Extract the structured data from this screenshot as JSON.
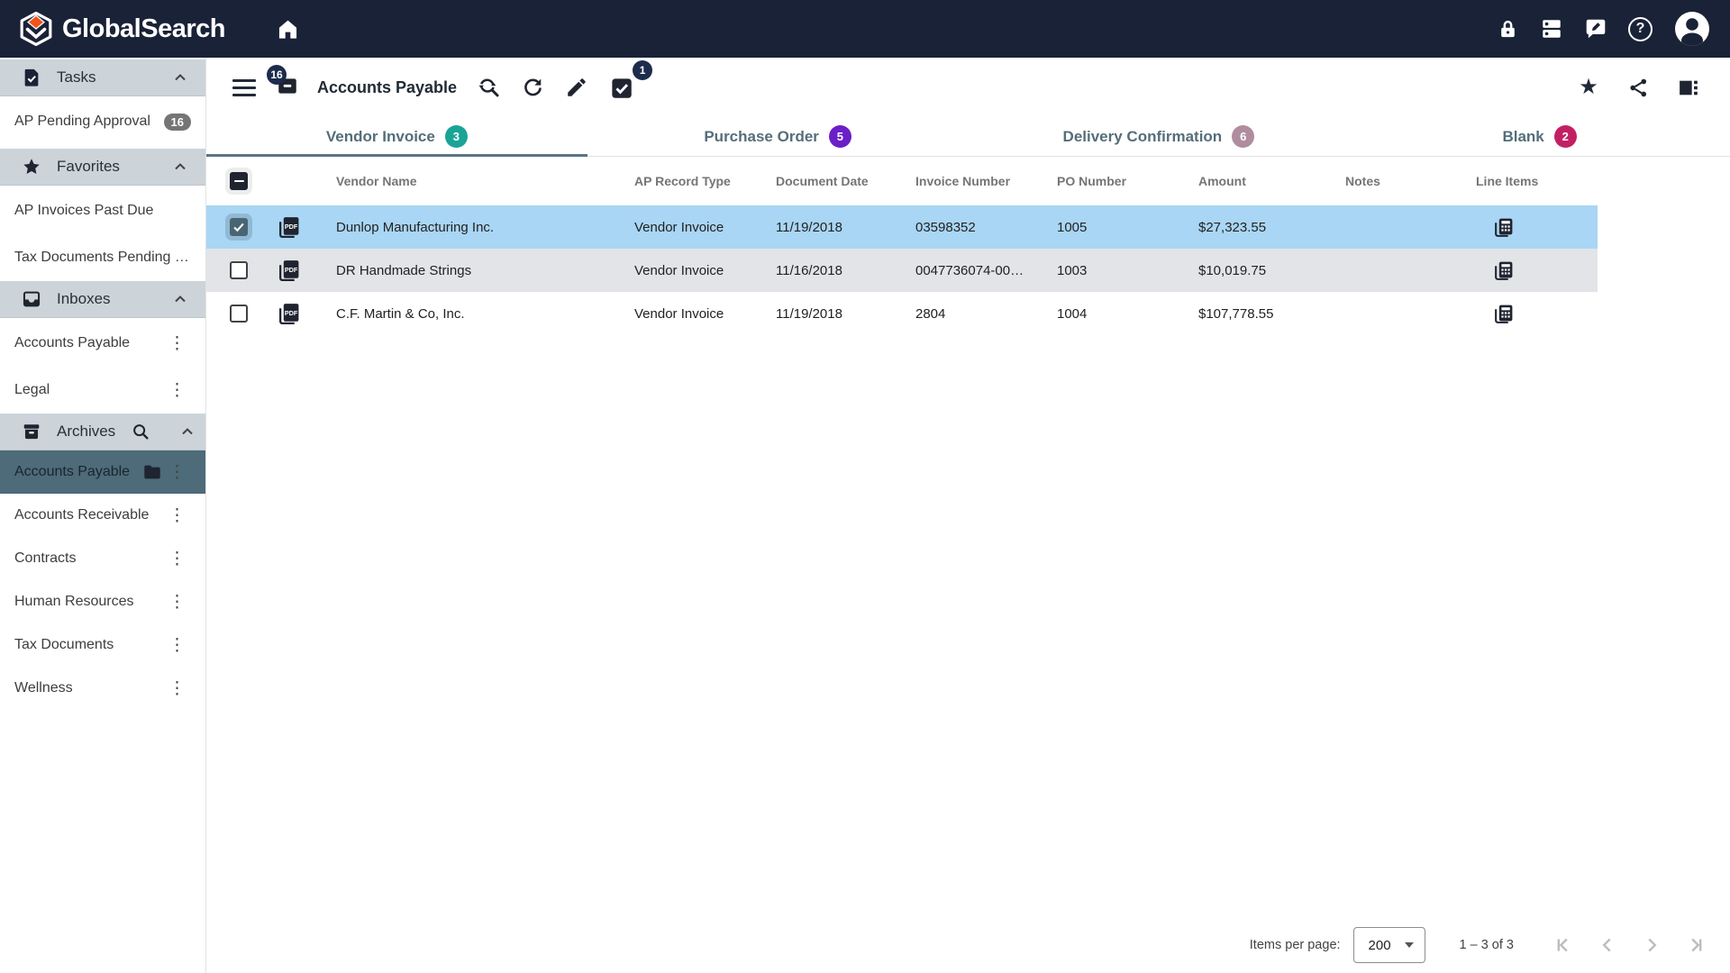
{
  "topbar": {
    "brand": "GlobalSearch",
    "icons": [
      "home-icon",
      "lock-icon",
      "dns-icon",
      "feedback-icon",
      "help-icon",
      "account-icon"
    ]
  },
  "sidebar": {
    "tasks": {
      "label": "Tasks",
      "items": [
        {
          "label": "AP Pending Approval",
          "badge": "16"
        }
      ]
    },
    "favorites": {
      "label": "Favorites",
      "items": [
        {
          "label": "AP Invoices Past Due"
        },
        {
          "label": "Tax Documents Pending Inde…"
        }
      ]
    },
    "inboxes": {
      "label": "Inboxes",
      "items": [
        {
          "label": "Accounts Payable"
        },
        {
          "label": "Legal"
        }
      ]
    },
    "archives": {
      "label": "Archives",
      "items": [
        {
          "label": "Accounts Payable",
          "selected": true
        },
        {
          "label": "Accounts Receivable"
        },
        {
          "label": "Contracts"
        },
        {
          "label": "Human Resources"
        },
        {
          "label": "Tax Documents"
        },
        {
          "label": "Wellness"
        }
      ]
    }
  },
  "toolbar": {
    "title": "Accounts Payable",
    "inbox_badge": "16",
    "multiselect_badge": "1"
  },
  "tabs": [
    {
      "label": "Vendor Invoice",
      "count": "3",
      "badge_color": "#19a496",
      "active": true
    },
    {
      "label": "Purchase Order",
      "count": "5",
      "badge_color": "#6b1fc7",
      "active": false
    },
    {
      "label": "Delivery Confirmation",
      "count": "6",
      "badge_color": "#b08c9f",
      "active": false
    },
    {
      "label": "Blank",
      "count": "2",
      "badge_color": "#c32064",
      "active": false
    }
  ],
  "table": {
    "headers": {
      "vendor": "Vendor Name",
      "type": "AP Record Type",
      "date": "Document Date",
      "invoice": "Invoice Number",
      "po": "PO Number",
      "amount": "Amount",
      "notes": "Notes",
      "line_items": "Line Items"
    },
    "rows": [
      {
        "vendor": "Dunlop Manufacturing Inc.",
        "type": "Vendor Invoice",
        "date": "11/19/2018",
        "invoice": "03598352",
        "po": "1005",
        "amount": "$27,323.55",
        "notes": "",
        "selected": true
      },
      {
        "vendor": "DR Handmade Strings",
        "type": "Vendor Invoice",
        "date": "11/16/2018",
        "invoice": "0047736074-00…",
        "po": "1003",
        "amount": "$10,019.75",
        "notes": "",
        "selected": false
      },
      {
        "vendor": "C.F. Martin & Co, Inc.",
        "type": "Vendor Invoice",
        "date": "11/19/2018",
        "invoice": "2804",
        "po": "1004",
        "amount": "$107,778.55",
        "notes": "",
        "selected": false
      }
    ]
  },
  "pagination": {
    "items_per_page_label": "Items per page:",
    "page_size": "200",
    "range_label": "1 – 3 of 3"
  },
  "colors": {
    "topbar_bg": "#1a2237",
    "badge_navy": "#1d2b4d",
    "selected_row": "#a9d6f4",
    "alt_row": "#e3e4e7",
    "sidebar_header_bg": "#ccd4d9",
    "sidebar_selected_bg": "#4d6b78",
    "tab_underline": "#5b7583",
    "task_badge_grey": "#757575",
    "logo_orange": "#f2541b"
  }
}
